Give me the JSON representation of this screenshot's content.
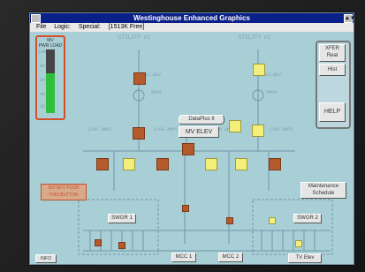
{
  "window": {
    "title": "Westinghouse Enhanced Graphics",
    "max_symbol": "▲▼"
  },
  "menu": {
    "items": [
      "File",
      "Logic",
      "Special",
      "[1513K Free]"
    ]
  },
  "gauge": {
    "title_line1": "MV",
    "title_line2": "PWR LOAD",
    "level": 0.62,
    "scale": [
      "100",
      "80",
      "60",
      "40",
      "20"
    ]
  },
  "diagram": {
    "utility_left": "UTILITY #1",
    "utility_right": "UTILITY #1",
    "rating_left": "5MVA",
    "rating_right": "5MVA",
    "kv_left": "13.8KV",
    "kv_right": "13.8KV",
    "main_bus_label": "DataPlus II",
    "mv_elev": "MV ELEV",
    "feed_labels": [
      "1200 AMPS",
      "1200 AMPS",
      "1200 AMPS",
      "1200 AMPS"
    ]
  },
  "buttons": {
    "xfer_line1": "XFER",
    "xfer_line2": "Real",
    "hist": "Hist",
    "help": "HELP",
    "do_not_push_1": "DO NOT PUSH",
    "do_not_push_2": "THIS BUTTON",
    "maintenance_1": "Maintenance",
    "maintenance_2": "Schedule",
    "swgr1": "SWGR 1",
    "swgr2": "SWGR 2",
    "mcc1": "MCC 1",
    "mcc2": "MCC 2",
    "tv_elev": "TV Elev",
    "info": "INFO"
  },
  "colors": {
    "background": "#a9cfd6",
    "title_bar": "#0a1f88",
    "breaker_open": "#b55a2a",
    "breaker_closed": "#f4ef7a",
    "gauge_fill": "#2fbf3a"
  }
}
